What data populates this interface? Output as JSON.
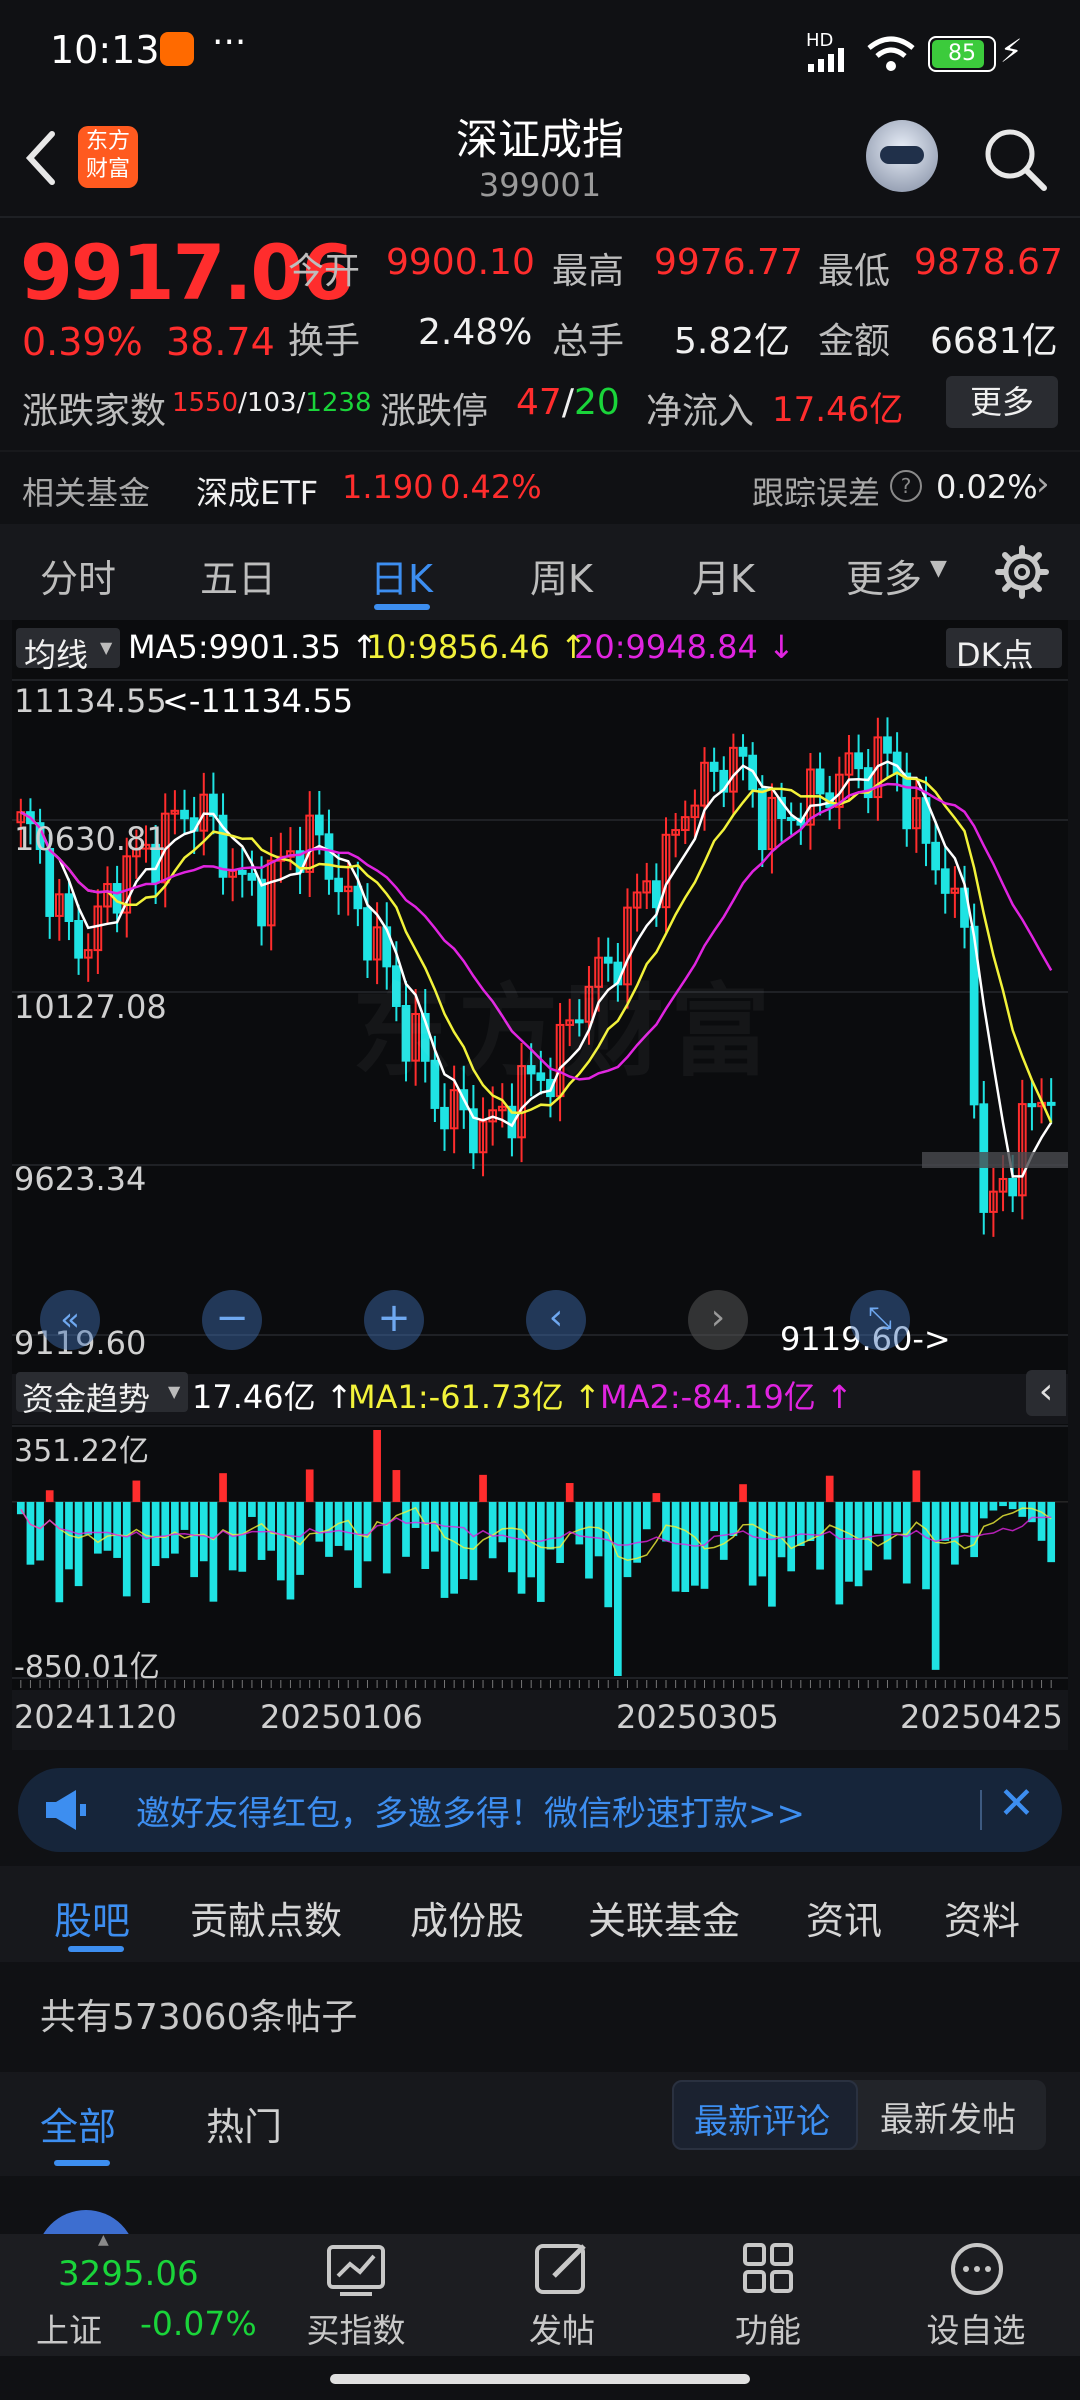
{
  "status_bar": {
    "time": "10:13",
    "network": "HD",
    "battery": "85"
  },
  "header": {
    "title": "深证成指",
    "code": "399001",
    "logo_text": "东方财富"
  },
  "quote": {
    "price": "9917.06",
    "change_pct": "0.39%",
    "change": "38.74",
    "open_label": "今开",
    "open": "9900.10",
    "high_label": "最高",
    "high": "9976.77",
    "low_label": "最低",
    "low": "9878.67",
    "turnover_label": "换手",
    "turnover": "2.48%",
    "volume_label": "总手",
    "volume": "5.82亿",
    "amount_label": "金额",
    "amount": "6681亿",
    "breadth_label": "涨跌家数",
    "up_count": "1550",
    "sep1": "/",
    "flat_count": "103",
    "sep2": "/",
    "down_count": "1238",
    "limit_label": "涨跌停",
    "limit_up": "47",
    "limit_sep": "/",
    "limit_down": "20",
    "netflow_label": "净流入",
    "netflow": "17.46亿",
    "more_button": "更多"
  },
  "fund_row": {
    "label": "相关基金",
    "fund_name": "深成ETF",
    "fund_price": "1.190",
    "fund_change": "0.42%",
    "tracking_label": "跟踪误差",
    "tracking_value": "0.02%"
  },
  "kline_tabs": [
    {
      "label": "分时",
      "active": false
    },
    {
      "label": "五日",
      "active": false
    },
    {
      "label": "日K",
      "active": true
    },
    {
      "label": "周K",
      "active": false
    },
    {
      "label": "月K",
      "active": false
    },
    {
      "label": "更多",
      "active": false
    }
  ],
  "indicators": {
    "ma_selector": "均线",
    "ma5": "MA5:9901.35",
    "ma10": "10:9856.46",
    "ma20": "20:9948.84",
    "dk_button": "DK点",
    "watermark": "东方财富"
  },
  "chart_data": {
    "type": "candlestick",
    "y_ticks": [
      "11134.55",
      "10630.81",
      "10127.08",
      "9623.34",
      "9119.60"
    ],
    "ylim": [
      9119.6,
      11134.55
    ],
    "max_label": "<-11134.55",
    "min_label": "9119.60->",
    "x_ticks": [
      "20241120",
      "20250106",
      "20250305",
      "20250425"
    ],
    "flow_panel": {
      "selector": "资金趋势",
      "value": "17.46亿",
      "ma1": "MA1:-61.73亿",
      "ma2": "MA2:-84.19亿",
      "top_label": "351.22亿",
      "bottom_label": "-850.01亿",
      "ylim": [
        -850.01,
        351.22
      ]
    }
  },
  "banner": {
    "text": "邀好友得红包，多邀多得！微信秒速打款>>"
  },
  "section_tabs": [
    {
      "label": "股吧",
      "active": true
    },
    {
      "label": "贡献点数",
      "active": false
    },
    {
      "label": "成份股",
      "active": false
    },
    {
      "label": "关联基金",
      "active": false
    },
    {
      "label": "资讯",
      "active": false
    },
    {
      "label": "资料",
      "active": false
    }
  ],
  "posts": {
    "count_text": "共有573060条帖子",
    "filter_all": "全部",
    "filter_hot": "热门",
    "sort_latest_comment": "最新评论",
    "sort_latest_post": "最新发帖"
  },
  "bottom_nav": {
    "index_name": "上证",
    "index_price": "3295.06",
    "index_change": "-0.07%",
    "buy_index": "买指数",
    "post": "发帖",
    "functions": "功能",
    "watchlist": "设自选"
  },
  "colors": {
    "up": "#ff2d2d",
    "down": "#1fe3e3",
    "ma5": "#ffffff",
    "ma10": "#f2f23a",
    "ma20": "#e024e0",
    "accent": "#3d8ef0"
  }
}
